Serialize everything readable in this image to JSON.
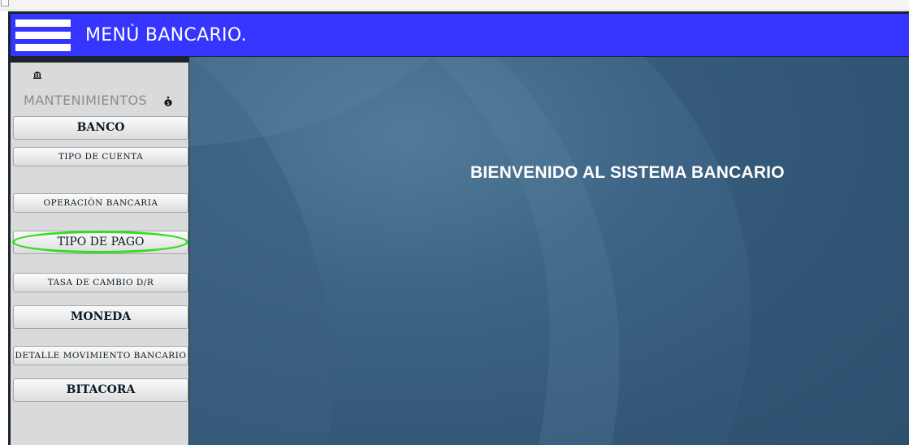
{
  "header": {
    "title": "MENÙ BANCARIO."
  },
  "sidebar": {
    "section_title": "MANTENIMIENTOS",
    "items": [
      {
        "label": "BANCO"
      },
      {
        "label": "TIPO DE CUENTA"
      },
      {
        "label": "OPERACIÒN BANCARIA"
      },
      {
        "label": "TIPO DE PAGO",
        "highlighted": true
      },
      {
        "label": "TASA DE CAMBIO D/R"
      },
      {
        "label": "MONEDA"
      },
      {
        "label": "DETALLE MOVIMIENTO BANCARIO"
      },
      {
        "label": "BITACORA"
      }
    ]
  },
  "main": {
    "welcome_text": "BIENVENIDO AL SISTEMA BANCARIO"
  },
  "colors": {
    "header_bg": "#3535ff",
    "sidebar_bg": "#d8dadb",
    "content_bg": "#3e6585",
    "highlight": "#2ede1e"
  },
  "icons": {
    "menu": "hamburger-icon",
    "bank": "bank-icon",
    "money": "money-bag-icon"
  }
}
